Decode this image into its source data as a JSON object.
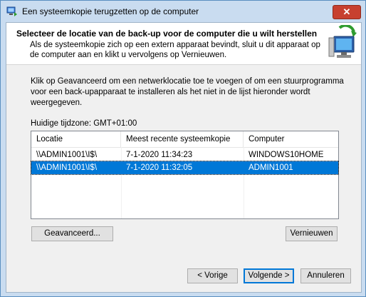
{
  "window": {
    "title": "Een systeemkopie terugzetten op de computer",
    "close_label": "✕"
  },
  "header": {
    "title": "Selecteer de locatie van de back-up voor de computer die u wilt herstellen",
    "description": "Als de systeemkopie zich op een extern apparaat bevindt, sluit u dit apparaat op de computer aan en klikt u vervolgens op Vernieuwen."
  },
  "main": {
    "intro": "Klik op Geavanceerd om een netwerklocatie toe te voegen of om een stuurprogramma voor een back-upapparaat te installeren als het niet in de lijst hieronder wordt weergegeven.",
    "timezone": "Huidige tijdzone: GMT+01:00",
    "table": {
      "columns": [
        "Locatie",
        "Meest recente systeemkopie",
        "Computer"
      ],
      "rows": [
        {
          "location": "\\\\ADMIN1001\\I$\\",
          "date": "7-1-2020 11:34:23",
          "computer": "WINDOWS10HOME",
          "selected": false
        },
        {
          "location": "\\\\ADMIN1001\\I$\\",
          "date": "7-1-2020 11:32:05",
          "computer": "ADMIN1001",
          "selected": true
        }
      ]
    },
    "advanced_label": "Geavanceerd...",
    "refresh_label": "Vernieuwen"
  },
  "footer": {
    "back_label": "< Vorige",
    "next_label": "Volgende >",
    "cancel_label": "Annuleren"
  },
  "colors": {
    "selection": "#0078d7",
    "close": "#c7402f",
    "frame": "#c9dcf0"
  }
}
